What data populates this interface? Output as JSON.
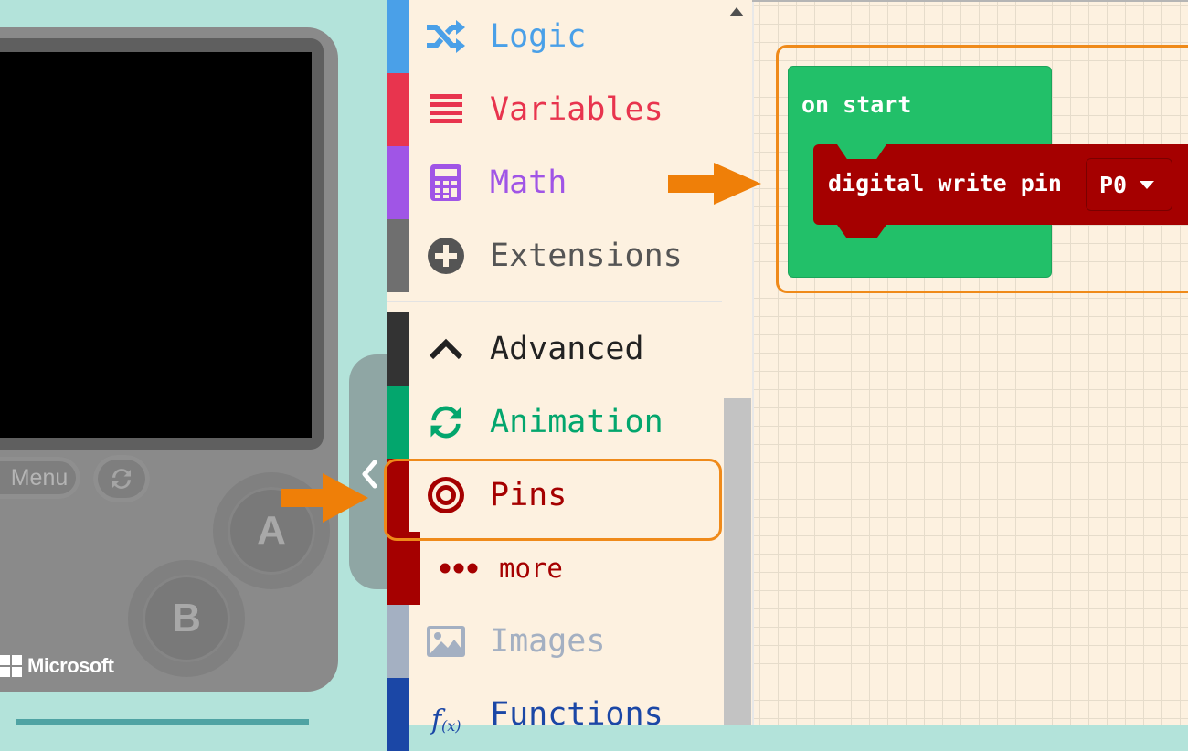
{
  "simulator": {
    "menu_label": "Menu",
    "button_a": "A",
    "button_b": "B",
    "brand": "Microsoft"
  },
  "toolbox": {
    "categories": [
      {
        "label": "Logic",
        "color": "#4aa0e8",
        "icon": "shuffle-icon"
      },
      {
        "label": "Variables",
        "color": "#e8344e",
        "icon": "list-icon"
      },
      {
        "label": "Math",
        "color": "#a055e6",
        "icon": "calculator-icon"
      },
      {
        "label": "Extensions",
        "color": "#6f6f6f",
        "icon": "plus-circle-icon"
      },
      {
        "label": "Advanced",
        "color": "#333333",
        "icon": "chevron-up-icon"
      },
      {
        "label": "Animation",
        "color": "#03a66d",
        "icon": "refresh-icon"
      },
      {
        "label": "Pins",
        "color": "#a50000",
        "icon": "target-icon"
      },
      {
        "label": "more",
        "color": "#a50000",
        "icon": "dots-icon"
      },
      {
        "label": "Images",
        "color": "#a4b0c2",
        "icon": "image-icon"
      },
      {
        "label": "Functions",
        "color": "#1b47a6",
        "icon": "function-icon"
      }
    ]
  },
  "workspace": {
    "on_start_label": "on start",
    "digital_write_label": "digital write pin",
    "pin_value": "P0"
  },
  "colors": {
    "highlight": "#ef8a1a",
    "event_green": "#22c069",
    "pins_red": "#a50000"
  }
}
